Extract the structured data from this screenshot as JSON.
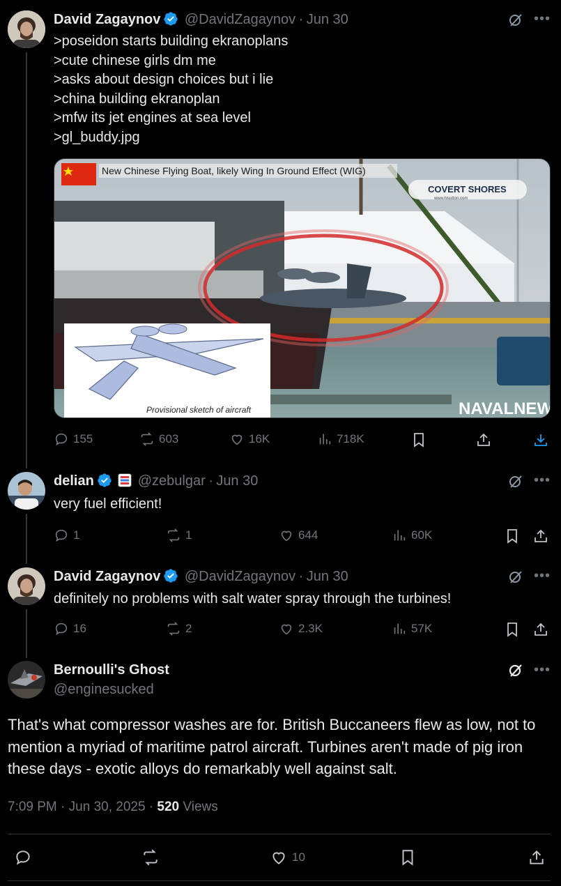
{
  "tweets": [
    {
      "name": "David Zagaynov",
      "handle": "@DavidZagaynov",
      "date": "Jun 30",
      "text": ">poseidon starts building ekranoplans\n>cute chinese girls dm me\n>asks about design choices but i lie\n>china building ekranoplan\n>mfw its jet engines at sea level\n>gl_buddy.jpg",
      "media": {
        "caption": "New Chinese Flying Boat, likely Wing In Ground Effect (WIG)",
        "watermark_top": "COVERT SHORES",
        "watermark_url": "www.hisutton.com",
        "watermark_bottom": "NAVALNEWS",
        "sketch_caption": "Provisional sketch of aircraft"
      },
      "stats": {
        "replies": "155",
        "reposts": "603",
        "likes": "16K",
        "views": "718K"
      }
    },
    {
      "name": "delian",
      "handle": "@zebulgar",
      "date": "Jun 30",
      "text": "very fuel efficient!",
      "stats": {
        "replies": "1",
        "reposts": "1",
        "likes": "644",
        "views": "60K"
      }
    },
    {
      "name": "David Zagaynov",
      "handle": "@DavidZagaynov",
      "date": "Jun 30",
      "text": "definitely no problems with salt water spray through the turbines!",
      "stats": {
        "replies": "16",
        "reposts": "2",
        "likes": "2.3K",
        "views": "57K"
      }
    }
  ],
  "main": {
    "name": "Bernoulli's Ghost",
    "handle": "@enginesucked",
    "text": "That's what compressor washes are for. British Buccaneers flew as low, not to mention a myriad of maritime patrol aircraft. Turbines aren't made of pig iron these days - exotic alloys do remarkably well against salt.",
    "time": "7:09 PM",
    "date": "Jun 30, 2025",
    "views_count": "520",
    "views_label": "Views",
    "likes": "10"
  },
  "separator": "·",
  "colors": {
    "verified": "#1d9bf0",
    "download": "#1d9bf0",
    "muted": "#71767b",
    "text": "#e7e9ea",
    "line": "#333639"
  }
}
